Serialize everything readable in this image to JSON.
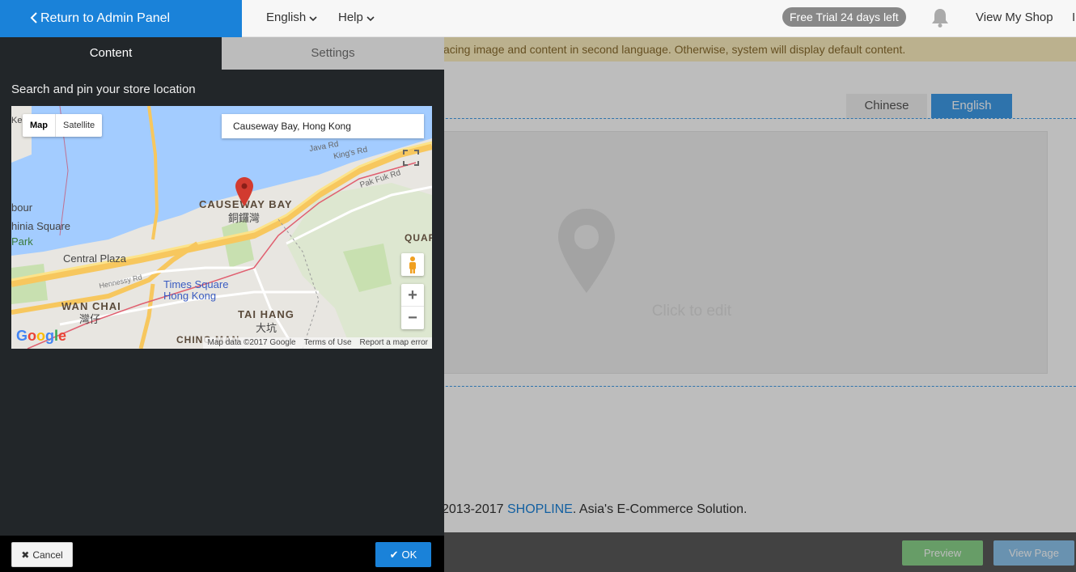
{
  "topbar": {
    "return_label": "Return to Admin Panel",
    "language_label": "English",
    "help_label": "Help",
    "trial_label": "Free Trial 24 days left",
    "view_shop_label": "View My Shop",
    "truncated_nav": "I"
  },
  "notice": {
    "text": "acing image and content in second language. Otherwise, system will display default content."
  },
  "page": {
    "lang_tabs": [
      "Chinese",
      "English"
    ],
    "active_lang": "English",
    "placeholder_text": "Click to edit",
    "footer_years": "2013-2017 ",
    "footer_brand": "SHOPLINE",
    "footer_tail": ". Asia's E-Commerce Solution."
  },
  "bottombar": {
    "preview_label": "Preview",
    "view_page_label": "View Page"
  },
  "panel": {
    "tabs": [
      "Content",
      "Settings"
    ],
    "active_tab": "Content",
    "label": "Search and pin your store location",
    "cancel_label": "Cancel",
    "ok_label": "OK"
  },
  "map": {
    "search_value": "Causeway Bay, Hong Kong",
    "map_type_options": [
      "Map",
      "Satellite"
    ],
    "map_type_selected": "Map",
    "attribution": [
      "Map data ©2017 Google",
      "Terms of Use",
      "Report a map error"
    ],
    "google_logo": "Google",
    "labels": {
      "causeway_bay": "CAUSEWAY BAY",
      "causeway_bay_zh": "銅鑼灣",
      "wan_chai": "WAN CHAI",
      "wan_chai_zh": "灣仔",
      "tai_hang": "TAI HANG",
      "tai_hang_zh": "大坑",
      "central_plaza": "Central Plaza",
      "times_square": "Times Square",
      "hong_kong": "Hong Kong",
      "harbour": "bour",
      "china_square": "hinia Square",
      "park": "Park",
      "hennessy_rd": "Hennessy Rd",
      "java_rd": "Java Rd",
      "kings_rd": "King's Rd",
      "pak_fuk_rd": "Pak Fuk Rd",
      "quarry": "QUAR",
      "ching_man": "CHING MAN",
      "left_ke": "Ke"
    }
  },
  "colors": {
    "brand_blue": "#1a82d9",
    "panel_bg": "#222629",
    "notice_bg": "#fcefc0",
    "preview_green": "#8bd48b"
  }
}
